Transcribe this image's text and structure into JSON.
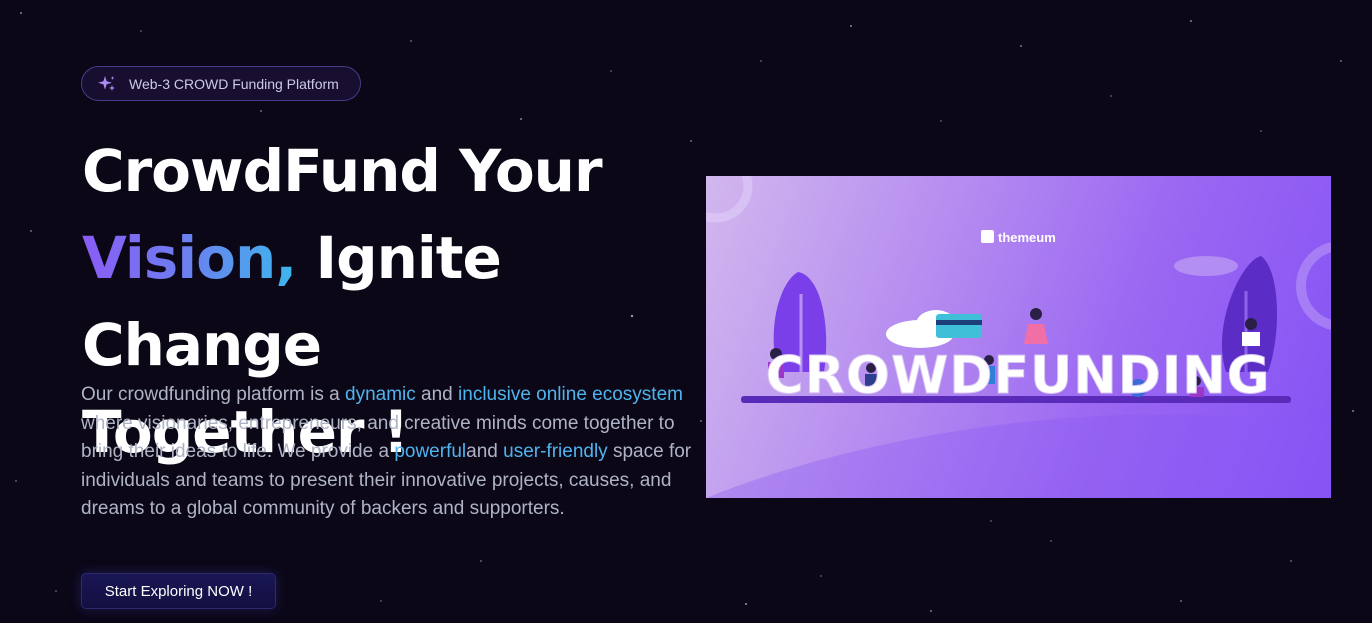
{
  "badge": {
    "icon": "sparkle-icon",
    "label": "Web-3 CROWD Funding Platform"
  },
  "hero": {
    "title_line1": "CrowdFund Your",
    "title_highlight": "Vision,",
    "title_line2_rest": " Ignite Change",
    "title_line3": "Together !",
    "description": {
      "t1": "Our crowdfunding platform is a ",
      "h1": "dynamic",
      "t2": " and ",
      "h2": "inclusive online ecosystem",
      "t3": " where visionaries, entrepreneurs, and creative minds come together to bring their ideas to life. We provide a ",
      "h3": "powerful",
      "t4": "and ",
      "h4": "user-friendly",
      "t5": " space for individuals and teams to present their innovative projects, causes, and dreams to a global community of backers and supporters."
    },
    "cta_label": "Start Exploring NOW !"
  },
  "illustration": {
    "brand": "themeum",
    "word": "CROWDFUNDING"
  },
  "colors": {
    "background": "#0b0717",
    "accent_gradient_start": "#8a5cf6",
    "accent_gradient_end": "#3cb6ec",
    "highlight_text": "#4fb4ee",
    "cta_background": "#1a1656"
  }
}
